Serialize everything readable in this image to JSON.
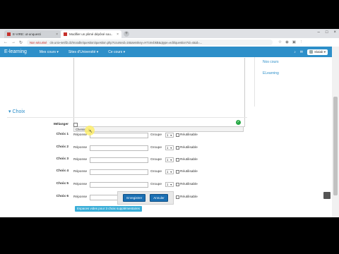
{
  "browser": {
    "tabs": [
      {
        "title": "E-VIRE: ut-unquesti"
      },
      {
        "title": "Modifier un plimé dépôsé sou.."
      }
    ],
    "security": "Non sécurisé",
    "url": "cle.univ-setif2.dz/moodle/question/question.php?courseid=16&sesskey=H7cmvbkB&qtype=edit/question?id=4&id=..."
  },
  "navbar": {
    "brand": "E-learning",
    "links": [
      "Mes cours ▾",
      "Sites d'Université ▾",
      "Ce cours ▾"
    ],
    "user": "Slalab ▾"
  },
  "side": {
    "links": [
      "Nos cours",
      "ELearning"
    ]
  },
  "editor": {
    "footer": "Chemin : p"
  },
  "section": {
    "title": "Choix"
  },
  "form": {
    "shuffle_label": "Mélanger",
    "answer_label": "Réponse",
    "group_label": "Groupe",
    "group_value": "1",
    "reusable_label": "Réutilisable",
    "choices": [
      "Choix 1",
      "Choix 2",
      "Choix 3",
      "Choix 4",
      "Choix 5",
      "Choix 6"
    ]
  },
  "buttons": {
    "save": "Enregistrer",
    "cancel": "Annuler",
    "add_choices": "Espaces vides pour 3 choix supplémentaires"
  }
}
